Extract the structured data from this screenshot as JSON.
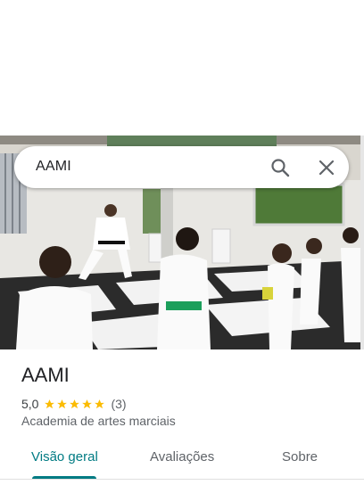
{
  "search": {
    "query": "AAMI"
  },
  "place": {
    "name": "AAMI",
    "rating": "5,0",
    "stars": 5,
    "review_count": "(3)",
    "category": "Academia de artes marciais"
  },
  "tabs": [
    {
      "label": "Visão geral",
      "active": true
    },
    {
      "label": "Avaliações",
      "active": false
    },
    {
      "label": "Sobre",
      "active": false
    }
  ],
  "icons": {
    "search": "search-icon",
    "close": "close-icon",
    "star": "star-icon"
  },
  "colors": {
    "accent": "#007b83",
    "star": "#fbbc04",
    "text_primary": "#202124",
    "text_secondary": "#5f6368"
  }
}
